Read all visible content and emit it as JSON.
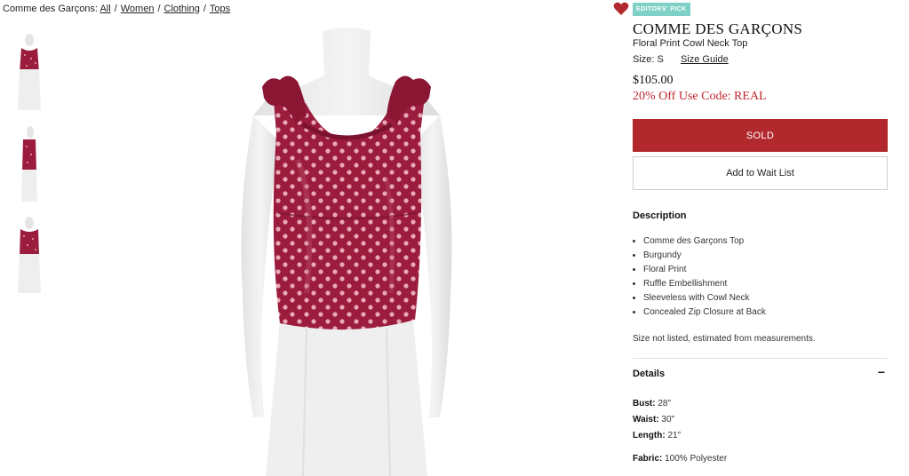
{
  "breadcrumb": {
    "prefix": "Comme des Garçons:",
    "links": [
      "All",
      "Women",
      "Clothing",
      "Tops"
    ]
  },
  "colors": {
    "sold": "#b2292d",
    "promo": "#c0262d",
    "badge": "#7fd1c7",
    "heart": "#b2292d",
    "top": "#9b1c3c"
  },
  "product": {
    "badge": "EDITORS' PICK",
    "designer": "COMME DES GARÇONS",
    "name": "Floral Print Cowl Neck Top",
    "size_label": "Size:",
    "size_value": "S",
    "size_guide": "Size Guide",
    "price": "$105.00",
    "promo": "20% Off Use Code: REAL",
    "sold_label": "SOLD",
    "waitlist_label": "Add to Wait List"
  },
  "description": {
    "title": "Description",
    "items": [
      "Comme des Garçons Top",
      "Burgundy",
      "Floral Print",
      "Ruffle Embellishment",
      "Sleeveless with Cowl Neck",
      "Concealed Zip Closure at Back"
    ],
    "size_note": "Size not listed, estimated from measurements."
  },
  "details": {
    "title": "Details",
    "toggle": "−",
    "measurements": [
      {
        "label": "Bust:",
        "value": "28\""
      },
      {
        "label": "Waist:",
        "value": "30\""
      },
      {
        "label": "Length:",
        "value": "21\""
      }
    ],
    "fabric": {
      "label": "Fabric:",
      "value": "100% Polyester"
    }
  },
  "icons": {
    "favorite": "heart-icon",
    "collapse": "minus-icon"
  }
}
